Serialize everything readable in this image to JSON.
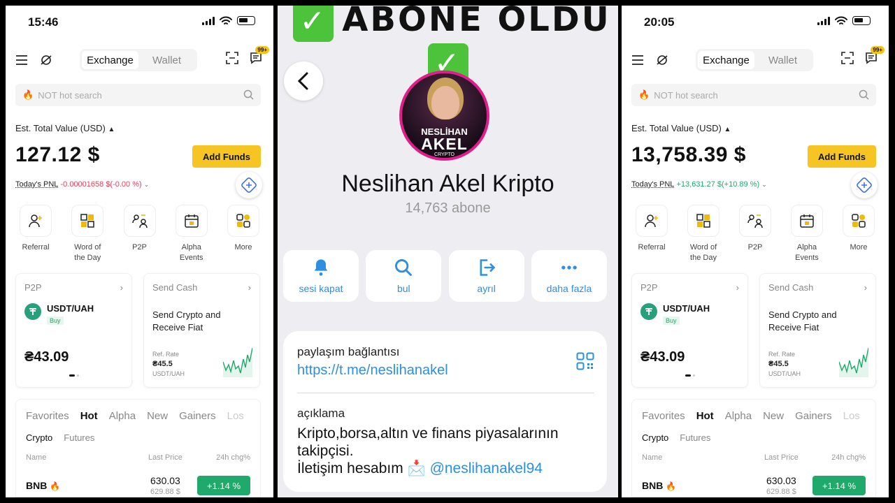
{
  "left_phone": {
    "time": "15:46",
    "tabs": {
      "exchange": "Exchange",
      "wallet": "Wallet"
    },
    "badge": "99+",
    "search_placeholder": "NOT hot search",
    "est_label": "Est. Total Value (USD)",
    "balance": "127.12 $",
    "add_funds": "Add Funds",
    "pnl_label": "Today's PNL",
    "pnl_value": "-0.00001658 $(-0.00 %)",
    "shortcuts": [
      {
        "icon": "referral-icon",
        "label": "Referral"
      },
      {
        "icon": "word-of-day-icon",
        "label": "Word of the Day"
      },
      {
        "icon": "p2p-icon",
        "label": "P2P"
      },
      {
        "icon": "alpha-events-icon",
        "label": "Alpha Events"
      },
      {
        "icon": "more-icon",
        "label": "More"
      }
    ],
    "p2p_card": {
      "title": "P2P",
      "pair": "USDT/UAH",
      "side": "Buy",
      "price": "₴43.09"
    },
    "send_card": {
      "title": "Send Cash",
      "text": "Send Crypto and Receive Fiat",
      "ref_label": "Ref. Rate",
      "ref_value": "₴45.5",
      "ref_pair": "USDT/UAH"
    },
    "market_tabs": [
      "Favorites",
      "Hot",
      "Alpha",
      "New",
      "Gainers",
      "Los"
    ],
    "market_active": "Hot",
    "sub_tabs": [
      "Crypto",
      "Futures"
    ],
    "columns": {
      "name": "Name",
      "last_price": "Last Price",
      "change": "24h chg%"
    },
    "row": {
      "name": "BNB",
      "price": "630.03",
      "sub_price": "629.88 $",
      "change": "+1.14 %"
    }
  },
  "right_phone": {
    "time": "20:05",
    "tabs": {
      "exchange": "Exchange",
      "wallet": "Wallet"
    },
    "badge": "99+",
    "search_placeholder": "NOT hot search",
    "est_label": "Est. Total Value (USD)",
    "balance": "13,758.39 $",
    "add_funds": "Add Funds",
    "pnl_label": "Today's PNL",
    "pnl_value": "+13,631.27 $(+10.89 %)",
    "shortcuts": [
      {
        "icon": "referral-icon",
        "label": "Referral"
      },
      {
        "icon": "word-of-day-icon",
        "label": "Word of the Day"
      },
      {
        "icon": "p2p-icon",
        "label": "P2P"
      },
      {
        "icon": "alpha-events-icon",
        "label": "Alpha Events"
      },
      {
        "icon": "more-icon",
        "label": "More"
      }
    ],
    "p2p_card": {
      "title": "P2P",
      "pair": "USDT/UAH",
      "side": "Buy",
      "price": "₴43.09"
    },
    "send_card": {
      "title": "Send Cash",
      "text": "Send Crypto and Receive Fiat",
      "ref_label": "Ref. Rate",
      "ref_value": "₴45.5",
      "ref_pair": "USDT/UAH"
    },
    "market_tabs": [
      "Favorites",
      "Hot",
      "Alpha",
      "New",
      "Gainers",
      "Los"
    ],
    "market_active": "Hot",
    "sub_tabs": [
      "Crypto",
      "Futures"
    ],
    "columns": {
      "name": "Name",
      "last_price": "Last Price",
      "change": "24h chg%"
    },
    "row": {
      "name": "BNB",
      "price": "630.03",
      "sub_price": "629.88 $",
      "change": "+1.14 %"
    }
  },
  "middle": {
    "header": "ABONE OLDU",
    "avatar_text": {
      "line1": "NESLİHAN",
      "line2": "AKEL",
      "line3": "CRYPTO"
    },
    "channel_name": "Neslihan Akel Kripto",
    "subscribers": "14,763 abone",
    "actions": [
      {
        "icon": "bell-icon",
        "label": "sesi kapat"
      },
      {
        "icon": "search-icon",
        "label": "bul"
      },
      {
        "icon": "leave-icon",
        "label": "ayrıl"
      },
      {
        "icon": "more-dots-icon",
        "label": "daha fazla"
      }
    ],
    "share_label": "paylaşım bağlantısı",
    "share_link": "https://t.me/neslihanakel",
    "desc_label": "açıklama",
    "desc_line1": "Kripto,borsa,altın ve finans piyasalarının takipçisi.",
    "desc_line2": "İletişim hesabım",
    "desc_handle": "@neslihanakel94"
  },
  "colors": {
    "accent_yellow": "#f6c523",
    "positive": "#1fa96a",
    "negative": "#e2415a",
    "telegram_blue": "#2c8fe0",
    "avatar_ring": "#e01d8a"
  }
}
